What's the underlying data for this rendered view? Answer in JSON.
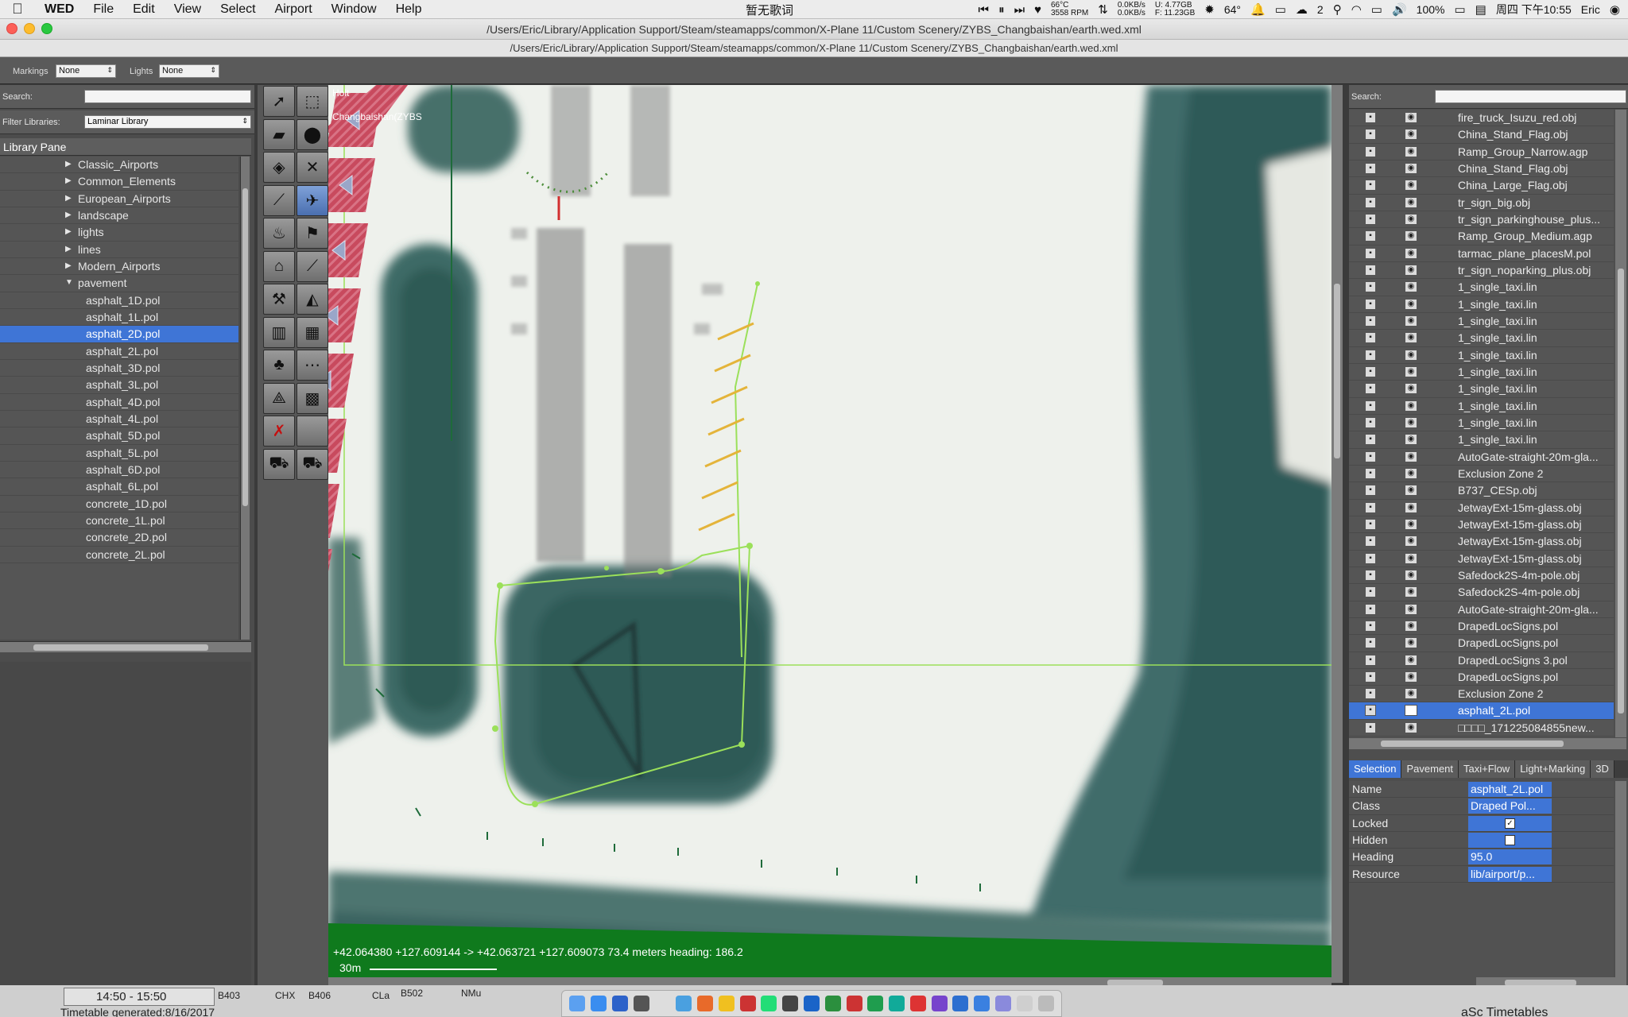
{
  "menubar": {
    "apple": "",
    "app_name": "WED",
    "menus": [
      "File",
      "Edit",
      "View",
      "Select",
      "Airport",
      "Window",
      "Help"
    ],
    "now_playing": "暂无歌词",
    "temp": "66°C",
    "rpm": "3558 RPM",
    "net_up": "0.0KB/s",
    "net_down": "0.0KB/s",
    "mem_u": "U: 4.77GB",
    "mem_f": "F: 11.23GB",
    "weather": "64°",
    "notif_count": "2",
    "battery": "100%",
    "datetime": "周四 下午10:55",
    "user": "Eric"
  },
  "window": {
    "title": "/Users/Eric/Library/Application Support/Steam/steamapps/common/X-Plane 11/Custom Scenery/ZYBS_Changbaishan/earth.wed.xml",
    "path": "/Users/Eric/Library/Application Support/Steam/steamapps/common/X-Plane 11/Custom Scenery/ZYBS_Changbaishan/earth.wed.xml"
  },
  "toolbar": {
    "markings_label": "Markings",
    "markings_value": "None",
    "lights_label": "Lights",
    "lights_value": "None"
  },
  "library": {
    "search_label": "Search:",
    "search_value": "",
    "filter_label": "Filter Libraries:",
    "filter_value": "Laminar Library",
    "pane_title": "Library Pane",
    "items": [
      {
        "label": "Classic_Airports",
        "level": 1,
        "folder": true,
        "open": false
      },
      {
        "label": "Common_Elements",
        "level": 1,
        "folder": true,
        "open": false
      },
      {
        "label": "European_Airports",
        "level": 1,
        "folder": true,
        "open": false
      },
      {
        "label": "landscape",
        "level": 1,
        "folder": true,
        "open": false
      },
      {
        "label": "lights",
        "level": 1,
        "folder": true,
        "open": false
      },
      {
        "label": "lines",
        "level": 1,
        "folder": true,
        "open": false
      },
      {
        "label": "Modern_Airports",
        "level": 1,
        "folder": true,
        "open": false
      },
      {
        "label": "pavement",
        "level": 1,
        "folder": true,
        "open": true
      },
      {
        "label": "asphalt_1D.pol",
        "level": 2
      },
      {
        "label": "asphalt_1L.pol",
        "level": 2
      },
      {
        "label": "asphalt_2D.pol",
        "level": 2,
        "selected": true
      },
      {
        "label": "asphalt_2L.pol",
        "level": 2
      },
      {
        "label": "asphalt_3D.pol",
        "level": 2
      },
      {
        "label": "asphalt_3L.pol",
        "level": 2
      },
      {
        "label": "asphalt_4D.pol",
        "level": 2
      },
      {
        "label": "asphalt_4L.pol",
        "level": 2
      },
      {
        "label": "asphalt_5D.pol",
        "level": 2
      },
      {
        "label": "asphalt_5L.pol",
        "level": 2
      },
      {
        "label": "asphalt_6D.pol",
        "level": 2
      },
      {
        "label": "asphalt_6L.pol",
        "level": 2
      },
      {
        "label": "concrete_1D.pol",
        "level": 2
      },
      {
        "label": "concrete_1L.pol",
        "level": 2
      },
      {
        "label": "concrete_2D.pol",
        "level": 2
      },
      {
        "label": "concrete_2L.pol",
        "level": 2
      }
    ]
  },
  "map": {
    "airport_label_1": "Holt",
    "airport_label_2": "Changbaishan(ZYBS",
    "coords": "+42.064380 +127.609144 -> +42.063721 +127.609073 73.4 meters heading: 186.2",
    "scale": "30m"
  },
  "objects": {
    "search_label": "Search:",
    "search_value": "",
    "items": [
      {
        "name": "fire_truck_Isuzu_red.obj",
        "visible": true
      },
      {
        "name": "China_Stand_Flag.obj",
        "visible": true
      },
      {
        "name": "Ramp_Group_Narrow.agp",
        "visible": true
      },
      {
        "name": "China_Stand_Flag.obj",
        "visible": true
      },
      {
        "name": "China_Large_Flag.obj",
        "visible": true
      },
      {
        "name": "tr_sign_big.obj",
        "visible": true
      },
      {
        "name": "tr_sign_parkinghouse_plus...",
        "visible": true
      },
      {
        "name": "Ramp_Group_Medium.agp",
        "visible": true
      },
      {
        "name": "tarmac_plane_placesM.pol",
        "visible": true
      },
      {
        "name": "tr_sign_noparking_plus.obj",
        "visible": true
      },
      {
        "name": "1_single_taxi.lin",
        "visible": true
      },
      {
        "name": "1_single_taxi.lin",
        "visible": true
      },
      {
        "name": "1_single_taxi.lin",
        "visible": true
      },
      {
        "name": "1_single_taxi.lin",
        "visible": true
      },
      {
        "name": "1_single_taxi.lin",
        "visible": true
      },
      {
        "name": "1_single_taxi.lin",
        "visible": true
      },
      {
        "name": "1_single_taxi.lin",
        "visible": true
      },
      {
        "name": "1_single_taxi.lin",
        "visible": true
      },
      {
        "name": "1_single_taxi.lin",
        "visible": true
      },
      {
        "name": "1_single_taxi.lin",
        "visible": true
      },
      {
        "name": "AutoGate-straight-20m-gla...",
        "visible": true
      },
      {
        "name": "Exclusion Zone 2",
        "visible": true
      },
      {
        "name": "B737_CESp.obj",
        "visible": true
      },
      {
        "name": "JetwayExt-15m-glass.obj",
        "visible": true
      },
      {
        "name": "JetwayExt-15m-glass.obj",
        "visible": true
      },
      {
        "name": "JetwayExt-15m-glass.obj",
        "visible": true
      },
      {
        "name": "JetwayExt-15m-glass.obj",
        "visible": true
      },
      {
        "name": "Safedock2S-4m-pole.obj",
        "visible": true
      },
      {
        "name": "Safedock2S-4m-pole.obj",
        "visible": true
      },
      {
        "name": "AutoGate-straight-20m-gla...",
        "visible": true
      },
      {
        "name": "DrapedLocSigns.pol",
        "visible": true
      },
      {
        "name": "DrapedLocSigns.pol",
        "visible": true
      },
      {
        "name": "DrapedLocSigns 3.pol",
        "visible": true
      },
      {
        "name": "DrapedLocSigns.pol",
        "visible": true
      },
      {
        "name": "Exclusion Zone 2",
        "visible": true
      },
      {
        "name": "asphalt_2L.pol",
        "visible": false,
        "selected": true
      },
      {
        "name": "□□□□_17122508485​5new...",
        "visible": true
      }
    ]
  },
  "properties": {
    "tabs": [
      {
        "label": "Selection",
        "active": true
      },
      {
        "label": "Pavement",
        "active": false
      },
      {
        "label": "Taxi+Flow",
        "active": false
      },
      {
        "label": "Light+Marking",
        "active": false
      },
      {
        "label": "3D",
        "active": false
      }
    ],
    "rows": [
      {
        "key": "Name",
        "value": "asphalt_2L.pol",
        "type": "text"
      },
      {
        "key": "Class",
        "value": "Draped Pol...",
        "type": "text"
      },
      {
        "key": "Locked",
        "value": "",
        "type": "checkbox",
        "checked": true
      },
      {
        "key": "Hidden",
        "value": "",
        "type": "checkbox",
        "checked": false
      },
      {
        "key": "Heading",
        "value": "95.0",
        "type": "text"
      },
      {
        "key": "Resource",
        "value": "lib/airport/p...",
        "type": "text"
      }
    ]
  },
  "background_window": {
    "time_range": "14:50 - 15:50",
    "c1": "B403",
    "c2": "CHX",
    "c3": "B406",
    "c4": "CLa",
    "c5": "B502",
    "c6": "NMu",
    "footer_left": "Timetable generated:8/16/2017",
    "footer_right": "aSc Timetables"
  },
  "colors": {
    "selection": "#3f75d6",
    "panel": "#4e4e4e",
    "map_line": "#9be05a",
    "stand_red": "#c84a5e",
    "grass": "#2d5a55"
  }
}
